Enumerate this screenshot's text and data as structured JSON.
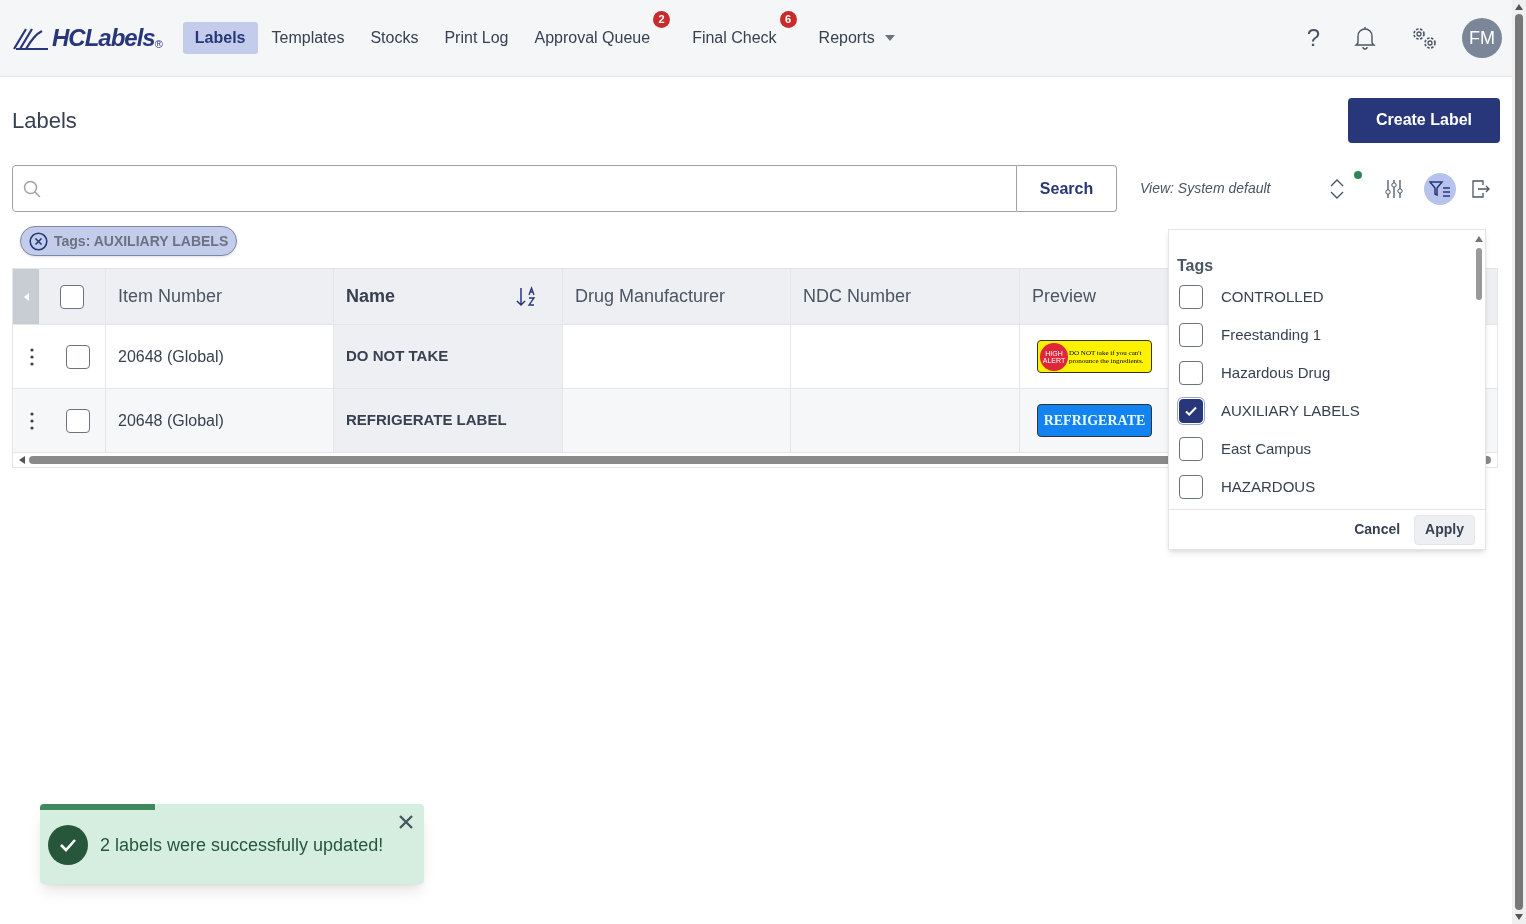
{
  "header": {
    "logo": {
      "text": "HCLabels",
      "mark": "®"
    },
    "nav": [
      {
        "label": "Labels",
        "selected": true
      },
      {
        "label": "Templates",
        "selected": false
      },
      {
        "label": "Stocks",
        "selected": false
      },
      {
        "label": "Print Log",
        "selected": false
      },
      {
        "label": "Approval Queue",
        "selected": false,
        "badge": "2"
      },
      {
        "label": "Final Check",
        "selected": false,
        "badge": "6"
      },
      {
        "label": "Reports",
        "selected": false,
        "dropdown": true
      }
    ],
    "help": "?",
    "avatar": "FM"
  },
  "page": {
    "title": "Labels",
    "create_button": "Create Label"
  },
  "search": {
    "button": "Search"
  },
  "view": {
    "label": "View: System default",
    "changed": true,
    "filter_active": true
  },
  "chips": [
    {
      "label": "Tags: AUXILIARY LABELS"
    }
  ],
  "table": {
    "select_all_checked": false,
    "columns": [
      {
        "label": "Item Number",
        "sorted": false
      },
      {
        "label": "Name",
        "sorted": true
      },
      {
        "label": "Drug Manufacturer",
        "sorted": false
      },
      {
        "label": "NDC Number",
        "sorted": false
      },
      {
        "label": "Preview",
        "sorted": false
      }
    ],
    "rows": [
      {
        "checked": false,
        "item_number": "20648 (Global)",
        "name": "DO NOT TAKE",
        "preview": {
          "kind": "alert",
          "badge": "HIGH ALERT",
          "text": "DO NOT take if you can't pronounce the ingredients."
        }
      },
      {
        "checked": false,
        "item_number": "20648 (Global)",
        "name": "REFRIGERATE LABEL",
        "preview": {
          "kind": "banner",
          "text": "REFRIGERATE"
        }
      }
    ]
  },
  "tag_filter": {
    "title": "Tags",
    "options": [
      {
        "label": "CONTROLLED",
        "checked": false
      },
      {
        "label": "Freestanding 1",
        "checked": false
      },
      {
        "label": "Hazardous Drug",
        "checked": false
      },
      {
        "label": "AUXILIARY LABELS",
        "checked": true
      },
      {
        "label": "East Campus",
        "checked": false
      },
      {
        "label": "HAZARDOUS",
        "checked": false
      }
    ],
    "cancel": "Cancel",
    "apply": "Apply"
  },
  "toast": {
    "message": "2 labels were successfully updated!",
    "level": 0.3
  }
}
